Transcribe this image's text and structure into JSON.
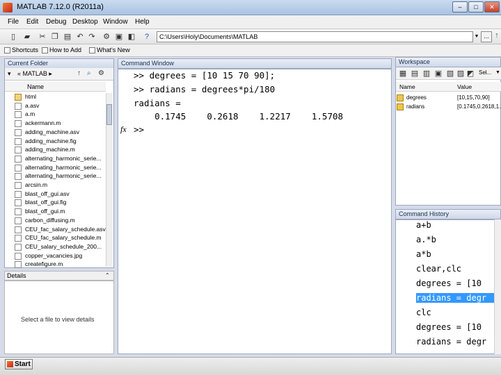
{
  "window": {
    "title": "MATLAB 7.12.0 (R2011a)",
    "minimize": "–",
    "maximize": "□",
    "close": "✕"
  },
  "menu": [
    "File",
    "Edit",
    "Debug",
    "Desktop",
    "Window",
    "Help"
  ],
  "toolbar": {
    "path": "C:\\Users\\Holy\\Documents\\MATLAB",
    "browse_label": "...",
    "path_dropdown": "▼"
  },
  "shortcuts": [
    "Shortcuts",
    "How to Add",
    "What's New"
  ],
  "current_folder": {
    "title": "Current Folder",
    "nav_path": "« MATLAB ▸",
    "column_name": "Name",
    "files": [
      {
        "name": "html",
        "kind": "folder"
      },
      {
        "name": "a.asv",
        "kind": "file"
      },
      {
        "name": "a.m",
        "kind": "mfile"
      },
      {
        "name": "ackermann.m",
        "kind": "mfile"
      },
      {
        "name": "adding_machine.asv",
        "kind": "file"
      },
      {
        "name": "adding_machine.fig",
        "kind": "file"
      },
      {
        "name": "adding_machine.m",
        "kind": "mfile"
      },
      {
        "name": "alternating_harmonic_serie...",
        "kind": "file"
      },
      {
        "name": "alternating_harmonic_serie...",
        "kind": "file"
      },
      {
        "name": "alternating_harmonic_serie...",
        "kind": "mfile"
      },
      {
        "name": "arcsin.m",
        "kind": "mfile"
      },
      {
        "name": "blast_off_gui.asv",
        "kind": "file"
      },
      {
        "name": "blast_off_gui.fig",
        "kind": "file"
      },
      {
        "name": "blast_off_gui.m",
        "kind": "mfile"
      },
      {
        "name": "carbon_diffusing.m",
        "kind": "mfile"
      },
      {
        "name": "CEU_fac_salary_schedule.asv",
        "kind": "file"
      },
      {
        "name": "CEU_fac_salary_schedule.m",
        "kind": "mfile"
      },
      {
        "name": "CEU_salary_schedule_200...",
        "kind": "file"
      },
      {
        "name": "copper_vacancies.jpg",
        "kind": "file"
      },
      {
        "name": "createfigure.m",
        "kind": "mfile"
      }
    ],
    "details_title": "Details",
    "details_message": "Select a file to view details"
  },
  "command_window": {
    "title": "Command Window",
    "lines": [
      ">> degrees = [10 15 70 90];",
      ">> radians = degrees*pi/180",
      "radians =",
      "    0.1745    0.2618    1.2217    1.5708",
      ">>"
    ],
    "fx": "fx"
  },
  "workspace": {
    "title": "Workspace",
    "select_label": "Sel...",
    "col_name": "Name",
    "col_value": "Value",
    "vars": [
      {
        "name": "degrees",
        "value": "[10,15,70,90]"
      },
      {
        "name": "radians",
        "value": "[0.1745,0.2618,1.2..."
      }
    ]
  },
  "command_history": {
    "title": "Command History",
    "items": [
      {
        "text": "a+b",
        "selected": false
      },
      {
        "text": "a.*b",
        "selected": false
      },
      {
        "text": "a*b",
        "selected": false
      },
      {
        "text": "clear,clc",
        "selected": false
      },
      {
        "text": "degrees = [10",
        "selected": false
      },
      {
        "text": "radians = degr",
        "selected": true
      },
      {
        "text": "clc",
        "selected": false
      },
      {
        "text": "degrees = [10",
        "selected": false
      },
      {
        "text": "radians = degr",
        "selected": false
      }
    ]
  },
  "status": {
    "start": "Start"
  }
}
